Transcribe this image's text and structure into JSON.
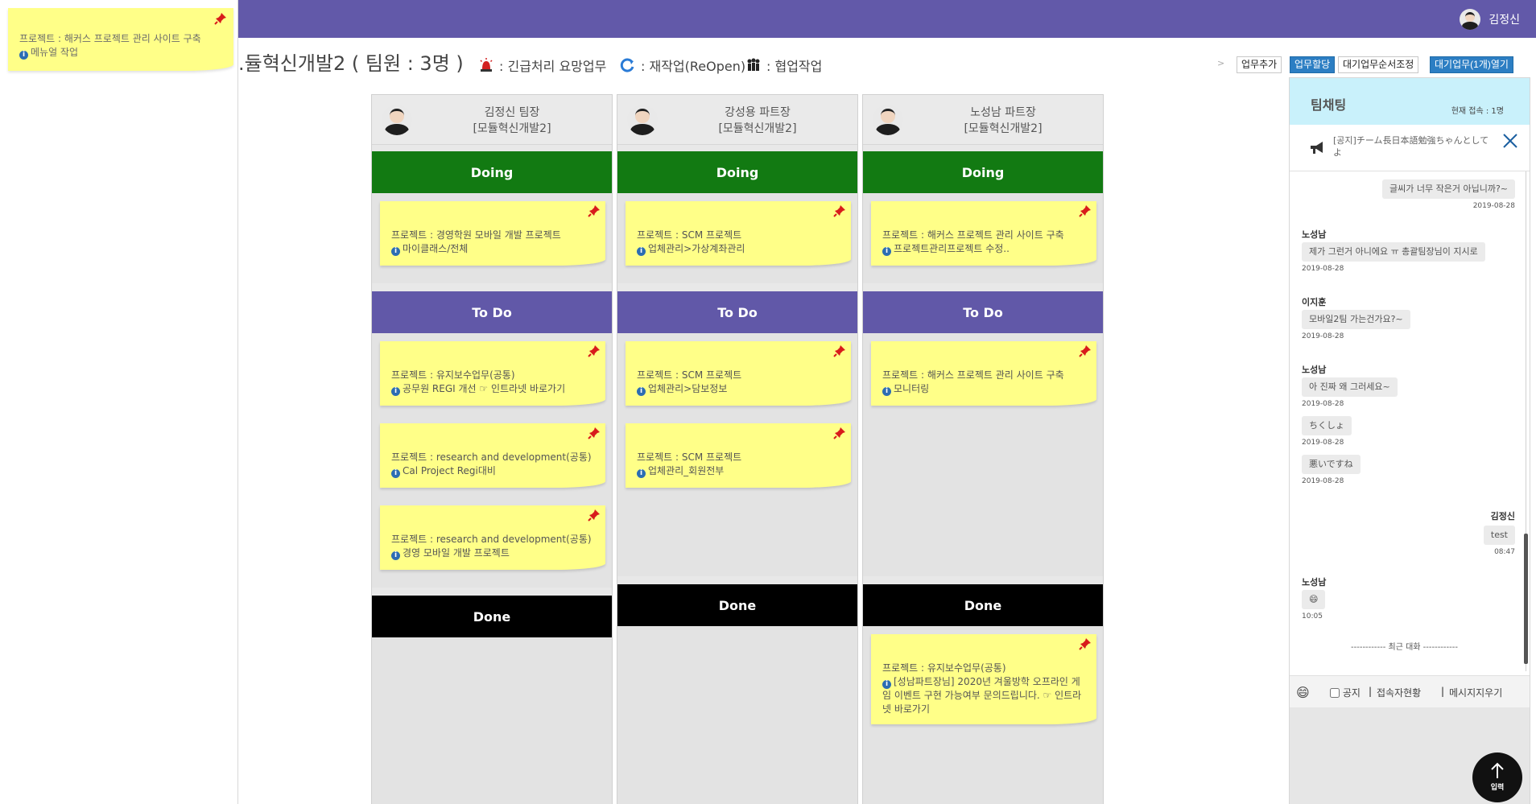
{
  "header": {
    "user_name": "김정신"
  },
  "floating_note": {
    "project": "프로젝트 : 해커스 프로젝트 관리 사이트 구축",
    "task": "메뉴얼 작업"
  },
  "page": {
    "team_title": ".듈혁신개발2 ( 팀원 : 3명 )",
    "legend": [
      {
        "icon": "siren-icon",
        "label": ": 긴급처리 요망업무"
      },
      {
        "icon": "reopen-icon",
        "label": ": 재작업(ReOpen)"
      },
      {
        "icon": "team-icon",
        "label": ": 협업작업"
      }
    ],
    "separator": ">",
    "buttons": {
      "add": "업무추가",
      "assign": "업무할당",
      "reorder": "대기업무순서조정",
      "open_waiting": "대기업무(1개)열기"
    }
  },
  "board": {
    "sections": {
      "doing": "Doing",
      "todo": "To Do",
      "done": "Done"
    },
    "columns": [
      {
        "name": "김정신 팀장",
        "team": "[모듈혁신개발2]",
        "doing": [
          {
            "project": "프로젝트 : 경영학원 모바일 개발 프로젝트",
            "task": "마이클래스/전체"
          }
        ],
        "todo": [
          {
            "project": "프로젝트 : 유지보수업무(공통)",
            "task": "공무원 REGI 개선  ☞ 인트라넷 바로가기"
          },
          {
            "project": "프로젝트 : research and development(공통)",
            "task": "Cal Project Regi대비"
          },
          {
            "project": "프로젝트 : research and development(공통)",
            "task": "경영 모바일 개발 프로젝트"
          }
        ],
        "done": []
      },
      {
        "name": "강성용 파트장",
        "team": "[모듈혁신개발2]",
        "doing": [
          {
            "project": "프로젝트 : SCM 프로젝트",
            "task": "업체관리>가상계좌관리"
          }
        ],
        "todo": [
          {
            "project": "프로젝트 : SCM 프로젝트",
            "task": "업체관리>담보정보"
          },
          {
            "project": "프로젝트 : SCM 프로젝트",
            "task": "업체관리_회원전부"
          }
        ],
        "done": []
      },
      {
        "name": "노성남 파트장",
        "team": "[모듈혁신개발2]",
        "doing": [
          {
            "project": "프로젝트 : 해커스 프로젝트 관리 사이트 구축",
            "task": "프로젝트관리프로젝트 수정.."
          }
        ],
        "todo": [
          {
            "project": "프로젝트 : 해커스 프로젝트 관리 사이트 구축",
            "task": "모니터링"
          }
        ],
        "done": [
          {
            "project": "프로젝트 : 유지보수업무(공통)",
            "task": "[성남파트장님] 2020년 겨울방학 오프라인 게임 이벤트 구현 가능여부 문의드립니다.  ☞ 인트라넷 바로가기"
          }
        ]
      }
    ]
  },
  "chat": {
    "title": "팀채팅",
    "online": "현재 접속 : 1명",
    "notice": "[공지]チーム長日本語勉強ちゃんとしてよ",
    "messages": [
      {
        "sender": "",
        "text": "글씨가 너무 작은거 아닙니까?~",
        "time": "2019-08-28"
      },
      {
        "sender": "노성남",
        "text": "제가 그런거 아니에요 ㅠ 총괄팀장님이 지시로",
        "time": "2019-08-28"
      },
      {
        "sender": "이지훈",
        "text": "모바일2팀 가는건가요?~",
        "time": "2019-08-28"
      },
      {
        "sender": "노성남",
        "text": "아 진짜 왜 그러세요~",
        "time": "2019-08-28"
      },
      {
        "sender": "",
        "text": "ちくしょ",
        "time": "2019-08-28"
      },
      {
        "sender": "",
        "text": "悪いですね",
        "time": "2019-08-28"
      },
      {
        "sender": "김정신",
        "text": "test",
        "time": "08:47"
      },
      {
        "sender": "노성남",
        "text": "😄",
        "time": "10:05"
      }
    ],
    "recent_divider": "------------ 최근 대화 ------------",
    "tools": {
      "notice_label": "공지",
      "users_label": "접속자현황",
      "clear_label": "메시지지우기"
    },
    "send_label": "입력"
  }
}
